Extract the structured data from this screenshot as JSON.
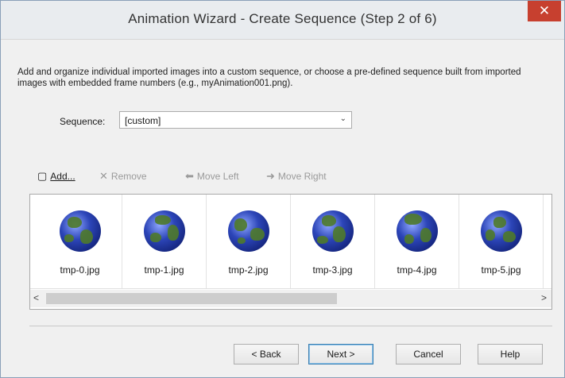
{
  "window": {
    "title": "Animation Wizard - Create Sequence (Step 2 of 6)",
    "close_glyph": "✕"
  },
  "description": "Add and organize individual imported images into a custom sequence, or choose a pre-defined sequence built from imported images with embedded frame numbers (e.g., myAnimation001.png).",
  "sequence": {
    "label": "Sequence:",
    "value": "[custom]",
    "arrow": "⌄"
  },
  "toolbar": {
    "add": {
      "icon": "▢",
      "label": "Add..."
    },
    "remove": {
      "icon": "✕",
      "label": "Remove"
    },
    "move_left": {
      "icon": "⬅",
      "label": "Move Left"
    },
    "move_right": {
      "icon": "➜",
      "label": "Move Right"
    }
  },
  "frames": [
    "tmp-0.jpg",
    "tmp-1.jpg",
    "tmp-2.jpg",
    "tmp-3.jpg",
    "tmp-4.jpg",
    "tmp-5.jpg"
  ],
  "scroll": {
    "left": "<",
    "right": ">"
  },
  "buttons": {
    "back": "< Back",
    "next": "Next >",
    "cancel": "Cancel",
    "help": "Help"
  },
  "colors": {
    "close_bg": "#c7402f",
    "globe_ocean": "#2c45b8",
    "globe_land": "#4f7a2a"
  }
}
